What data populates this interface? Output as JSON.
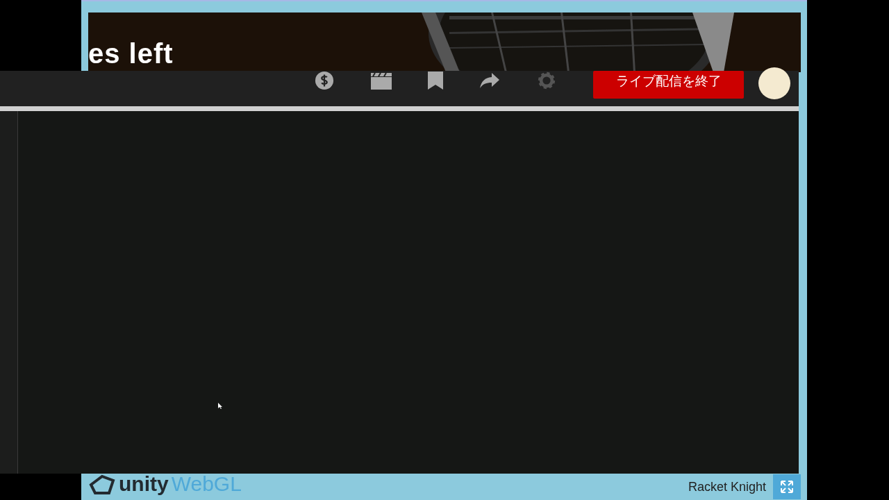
{
  "game": {
    "caption": "es left"
  },
  "toolbar": {
    "end_stream_button": "ライブ配信を終了"
  },
  "footer": {
    "logo_brand": "unity",
    "logo_product": "WebGL",
    "game_title": "Racket Knight"
  }
}
